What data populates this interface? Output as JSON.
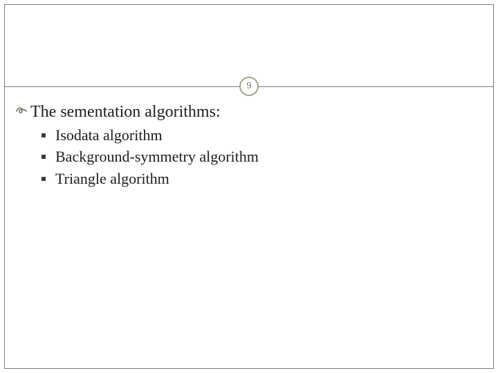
{
  "page_number": "9",
  "heading": "The sementation algorithms:",
  "items": [
    "Isodata algorithm",
    "Background-symmetry algorithm",
    "Triangle algorithm"
  ],
  "colors": {
    "border": "#7a7a7a",
    "badge_ring": "#a7a08a",
    "text": "#1d1d1d",
    "bullet": "#6b6554"
  }
}
